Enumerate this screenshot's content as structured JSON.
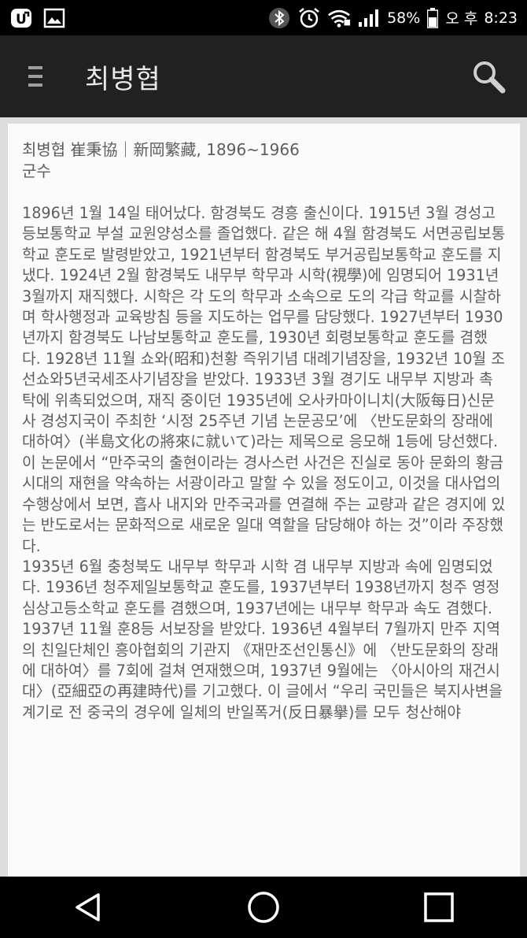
{
  "status": {
    "battery": "58%",
    "ampm": "오 후",
    "time": "8:23"
  },
  "app": {
    "title": "최병협"
  },
  "article": {
    "heading": "최병협 崔秉協｜新岡繁藏, 1896~1966",
    "role": "군수",
    "paragraphs": [
      "1896년 1월 14일 태어났다. 함경북도 경흥 출신이다. 1915년 3월 경성고등보통학교 부설 교원양성소를 졸업했다. 같은 해 4월 함경북도 서면공립보통학교 훈도로 발령받았고, 1921년부터 함경북도 부거공립보통학교 훈도를 지냈다. 1924년 2월 함경북도 내무부 학무과 시학(視學)에 임명되어 1931년 3월까지 재직했다. 시학은 각 도의 학무과 소속으로 도의 각급 학교를 시찰하며 학사행정과 교육방침 등을 지도하는 업무를 담당했다. 1927년부터 1930년까지 함경북도 나남보통학교 훈도를, 1930년 회령보통학교 훈도를 겸했다. 1928년 11월 쇼와(昭和)천황 즉위기념 대례기념장을, 1932년 10월 조선쇼와5년국세조사기념장을 받았다. 1933년 3월 경기도 내무부 지방과 촉탁에 위촉되었으며, 재직 중이던 1935년에 오사카마이니치(大阪每日)신문사 경성지국이 주최한 ‘시정 25주년 기념 논문공모’에 〈반도문화의 장래에 대하여〉(半島文化の將來に就いて)라는 제목으로 응모해 1등에 당선했다. 이 논문에서 “만주국의 출현이라는 경사스런 사건은 진실로 동아 문화의 황금시대의 재현을 약속하는 서광이라고 말할 수 있을 정도이고, 이것을 대사업의 수행상에서 보면, 흡사 내지와 만주국과를 연결해 주는 교량과 같은 경지에 있는 반도로서는 문화적으로 새로운 일대 역할을 담당해야 하는 것”이라 주장했다.",
      "1935년 6월 충청북도 내무부 학무과 시학 겸 내무부 지방과 속에 임명되었다. 1936년 청주제일보통학교 훈도를, 1937년부터 1938년까지 청주 영정심상고등소학교 훈도를 겸했으며, 1937년에는 내무부 학무과 속도 겸했다. 1937년 11월 훈8등 서보장을 받았다. 1936년 4월부터 7월까지 만주 지역의 친일단체인 흥아협회의 기관지 《재만조선인통신》에 〈반도문화의 장래에 대하여〉를 7회에 걸쳐 연재했으며, 1937년 9월에는 〈아시아의 재건시대〉(亞細亞の再建時代)를 기고했다. 이 글에서 “우리 국민들은 북지사변을 계기로 전 중국의 경우에 일체의 반일폭거(反日暴擧)를 모두 청산해야"
    ]
  }
}
